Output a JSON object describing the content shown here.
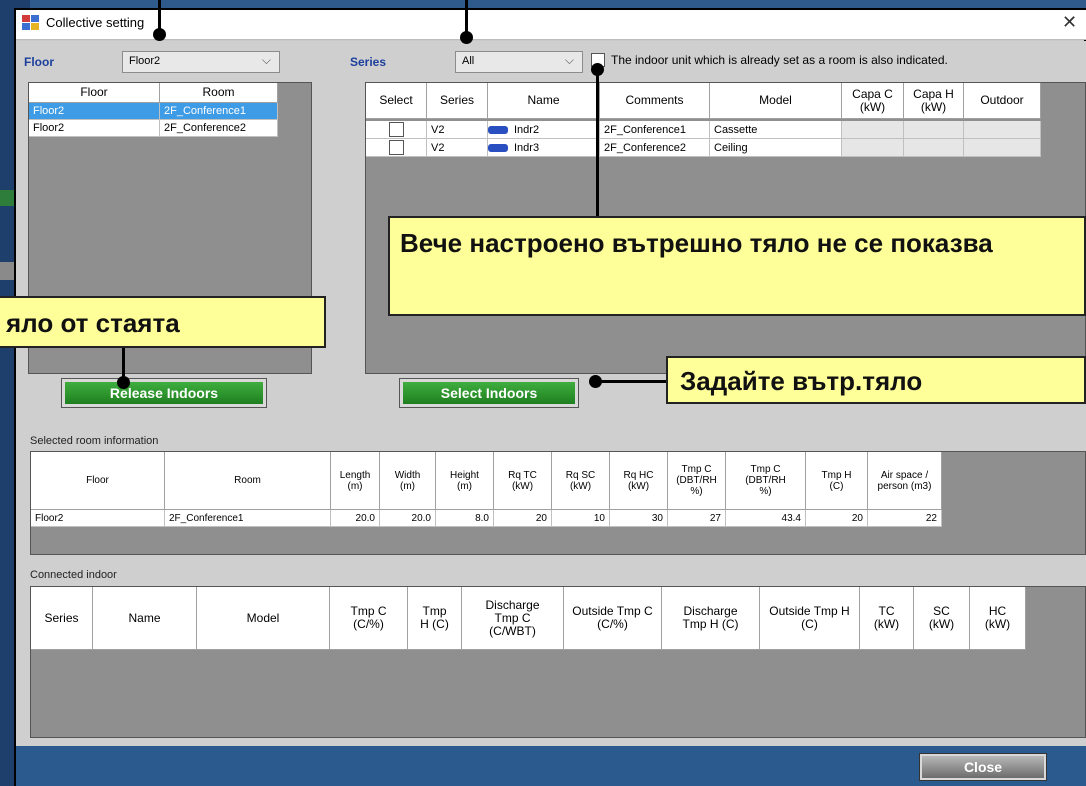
{
  "window": {
    "title": "Collective setting",
    "close_glyph": "✕"
  },
  "floor_filter": {
    "label": "Floor",
    "value": "Floor2"
  },
  "series_filter": {
    "label": "Series",
    "value": "All"
  },
  "show_set_units": {
    "checked": false,
    "label": "The indoor unit which is already set as a room is also indicated."
  },
  "room_list": {
    "headers": [
      "Floor",
      "Room"
    ],
    "rows": [
      {
        "floor": "Floor2",
        "room": "2F_Conference1",
        "selected": true
      },
      {
        "floor": "Floor2",
        "room": "2F_Conference2",
        "selected": false
      }
    ]
  },
  "indoor_list": {
    "headers": {
      "select": "Select",
      "series": "Series",
      "name": "Name",
      "comments": "Comments",
      "model": "Model",
      "capa_c": "Capa C (kW)",
      "capa_h": "Capa H (kW)",
      "outdoor": "Outdoor"
    },
    "rows": [
      {
        "series": "V2",
        "name": "Indr2",
        "comments": "2F_Conference1",
        "model": "Cassette",
        "icon": "indoor-unit-icon"
      },
      {
        "series": "V2",
        "name": "Indr3",
        "comments": "2F_Conference2",
        "model": "Ceiling",
        "icon": "indoor-unit-icon"
      }
    ]
  },
  "buttons": {
    "release": "Release Indoors",
    "select": "Select Indoors",
    "close": "Close"
  },
  "selected_room": {
    "section_label": "Selected room information",
    "headers": {
      "floor": "Floor",
      "room": "Room",
      "length": "Length (m)",
      "width": "Width (m)",
      "height": "Height (m)",
      "rq_tc": "Rq TC (kW)",
      "rq_sc": "Rq SC (kW)",
      "rq_hc": "Rq HC (kW)",
      "tmp_c_1": "Tmp C (DBT/RH %)",
      "tmp_c_2": "Tmp C (DBT/RH %)",
      "tmp_h": "Tmp H (C)",
      "air": "Air space / person (m3)"
    },
    "row": {
      "floor": "Floor2",
      "room": "2F_Conference1",
      "length": "20.0",
      "width": "20.0",
      "height": "8.0",
      "rq_tc": "20",
      "rq_sc": "10",
      "rq_hc": "30",
      "tmp_c_1": "27",
      "tmp_c_2": "43.4",
      "tmp_h": "20",
      "air": "22"
    }
  },
  "connected": {
    "section_label": "Connected indoor",
    "headers": {
      "series": "Series",
      "name": "Name",
      "model": "Model",
      "tmp_c": "Tmp C (C/%)",
      "tmp_h": "Tmp H (C)",
      "dis_c": "Discharge Tmp C (C/WBT)",
      "out_c": "Outside Tmp C (C/%)",
      "dis_h": "Discharge Tmp H (C)",
      "out_h": "Outside Tmp H (C)",
      "tc": "TC (kW)",
      "sc": "SC (kW)",
      "hc": "HC (kW)"
    }
  },
  "callouts": {
    "already_set": "Вече настроено вътрешно тяло не се показва",
    "from_room": "яло от стаята",
    "set_indoor": "Задайте вътр.тяло"
  }
}
